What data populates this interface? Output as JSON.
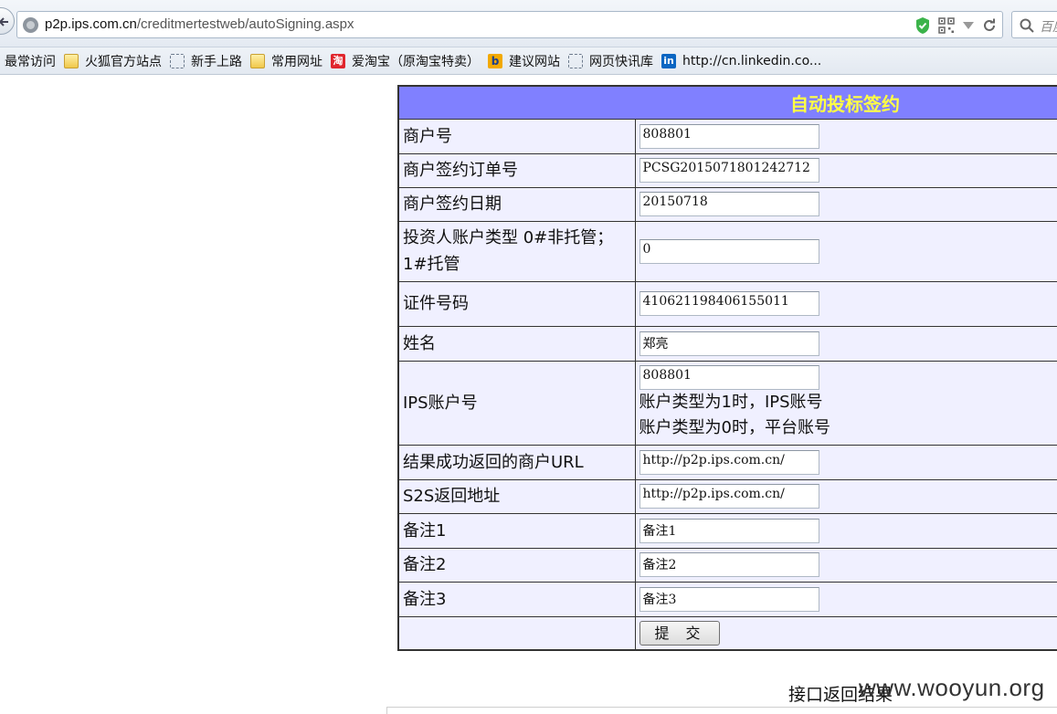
{
  "browser": {
    "url_host": "p2p.ips.com.cn",
    "url_path": "/creditmertestweb/autoSigning.aspx",
    "search_placeholder": "百度",
    "bookmarks": [
      {
        "label": "最常访问",
        "icon": ""
      },
      {
        "label": "火狐官方站点",
        "icon": "folder-icon"
      },
      {
        "label": "新手上路",
        "icon": "page-icon"
      },
      {
        "label": "常用网址",
        "icon": "folder-icon"
      },
      {
        "label": "爱淘宝（原淘宝特卖）",
        "icon": "taobao-icon"
      },
      {
        "label": "建议网站",
        "icon": "bing-icon"
      },
      {
        "label": "网页快讯库",
        "icon": "page-icon"
      },
      {
        "label": "http://cn.linkedin.co...",
        "icon": "linkedin-icon"
      }
    ]
  },
  "form": {
    "title": "自动投标签约",
    "rows": [
      {
        "label": "商户号",
        "value": "808801"
      },
      {
        "label": "商户签约订单号",
        "value": "PCSG2015071801242712"
      },
      {
        "label": "商户签约日期",
        "value": "20150718"
      },
      {
        "label": "投资人账户类型 0#非托管；1#托管",
        "value": "0"
      },
      {
        "label": "证件号码",
        "value": "410621198406155011"
      },
      {
        "label": "姓名",
        "value": "郑亮"
      },
      {
        "label": "IPS账户号",
        "value": "808801",
        "note1": "账户类型为1时，IPS账号",
        "note2": "账户类型为0时，平台账号"
      },
      {
        "label": "结果成功返回的商户URL",
        "value": "http://p2p.ips.com.cn/"
      },
      {
        "label": "S2S返回地址",
        "value": "http://p2p.ips.com.cn/"
      },
      {
        "label": "备注1",
        "value": "备注1"
      },
      {
        "label": "备注2",
        "value": "备注2"
      },
      {
        "label": "备注3",
        "value": "备注3"
      }
    ],
    "submit_label": "提交"
  },
  "result_label": "接口返回结果",
  "watermark": "www.wooyun.org",
  "colors": {
    "header_bg": "#8080ff",
    "header_text": "#ffff44",
    "cell_bg": "#f0f0ff"
  }
}
